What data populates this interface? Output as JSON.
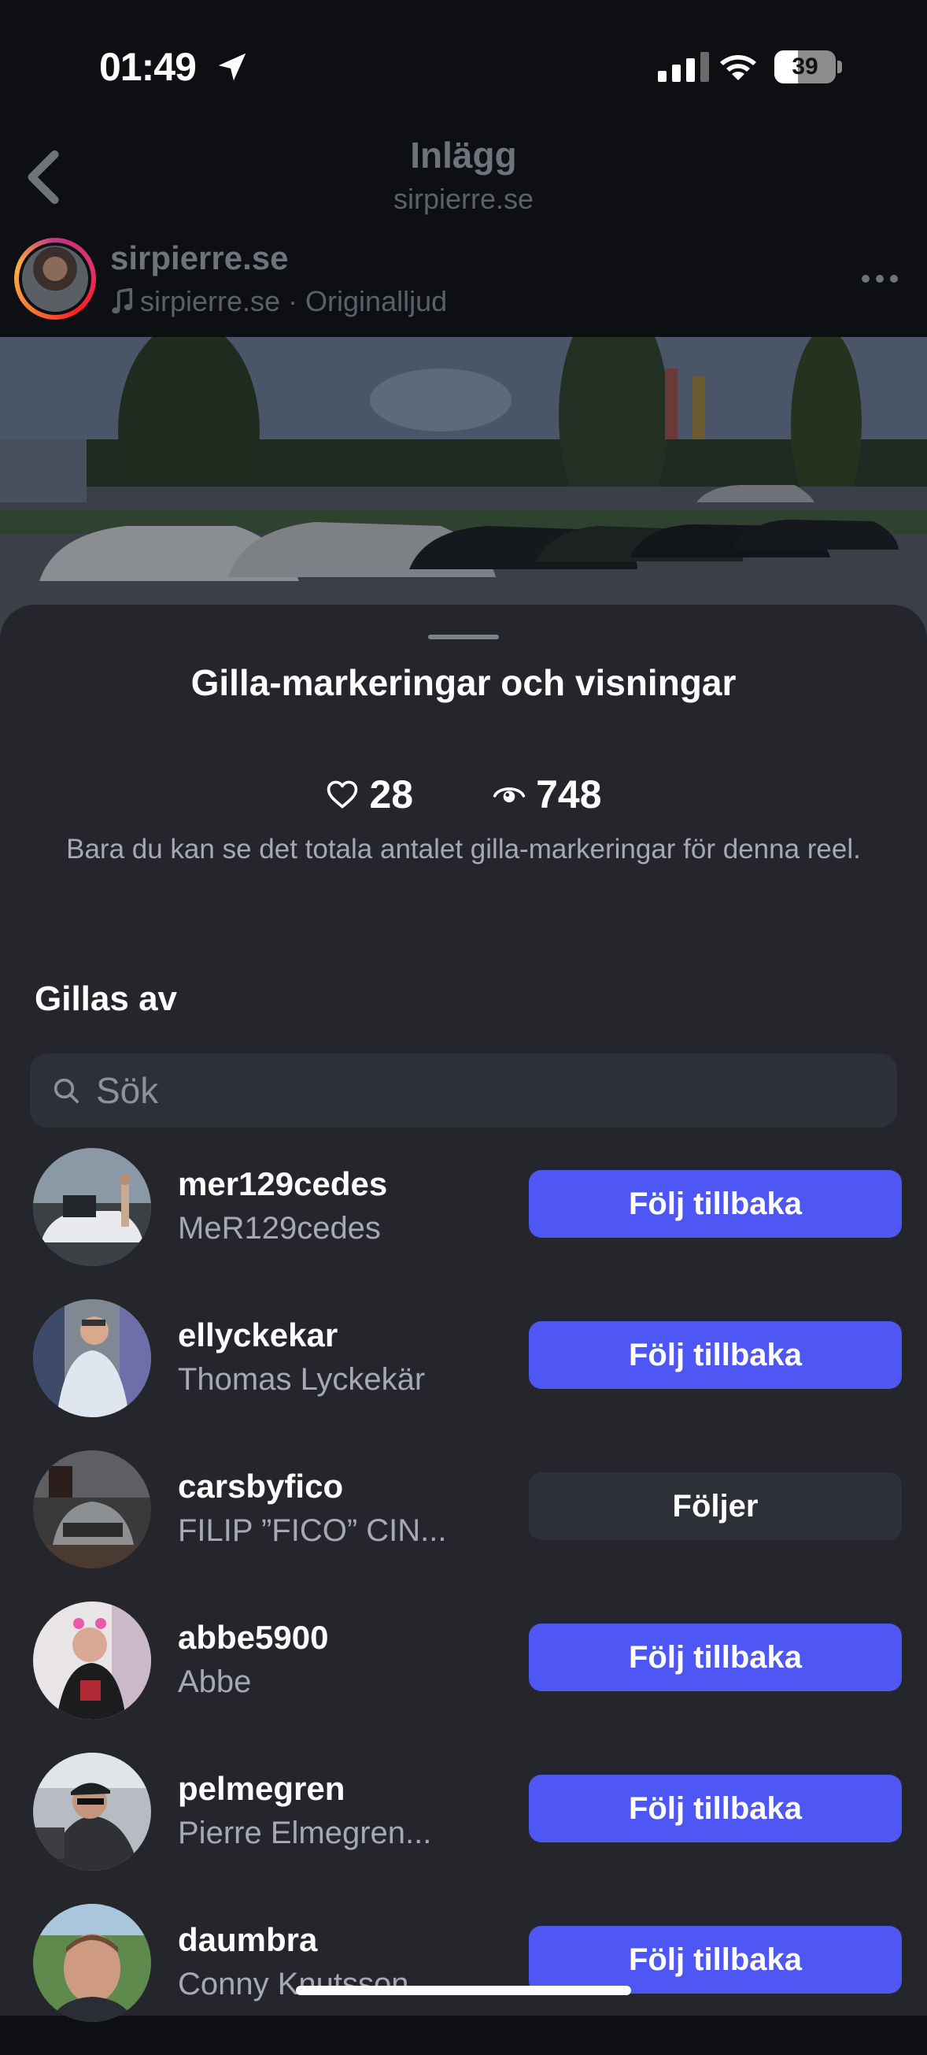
{
  "status_bar": {
    "time": "01:49",
    "battery": "39",
    "battery_level": 0.39
  },
  "nav": {
    "title": "Inlägg",
    "subtitle": "sirpierre.se"
  },
  "post": {
    "username": "sirpierre.se",
    "audio": "sirpierre.se · Originalljud"
  },
  "sheet": {
    "title": "Gilla-markeringar och visningar",
    "likes": "28",
    "views": "748",
    "note": "Bara du kan se det totala antalet gilla-markeringar för denna reel.",
    "section_title": "Gillas av",
    "search_placeholder": "Sök"
  },
  "likers": [
    {
      "username": "mer129cedes",
      "name": "MeR129cedes",
      "button": "Följ tillbaka",
      "style": "primary"
    },
    {
      "username": "ellyckekar",
      "name": "Thomas Lyckekär",
      "button": "Följ tillbaka",
      "style": "primary"
    },
    {
      "username": "carsbyfico",
      "name": "FILIP ”FICO” CIN...",
      "button": "Följer",
      "style": "secondary"
    },
    {
      "username": "abbe5900",
      "name": "Abbe",
      "button": "Följ tillbaka",
      "style": "primary"
    },
    {
      "username": "pelmegren",
      "name": "Pierre Elmegren...",
      "button": "Följ tillbaka",
      "style": "primary"
    },
    {
      "username": "daumbra",
      "name": "Conny Knutsson",
      "button": "Följ tillbaka",
      "style": "primary"
    }
  ],
  "colors": {
    "sheet_bg": "#24262c",
    "accent_button": "#4e57f3",
    "secondary_button": "#2e3037"
  }
}
